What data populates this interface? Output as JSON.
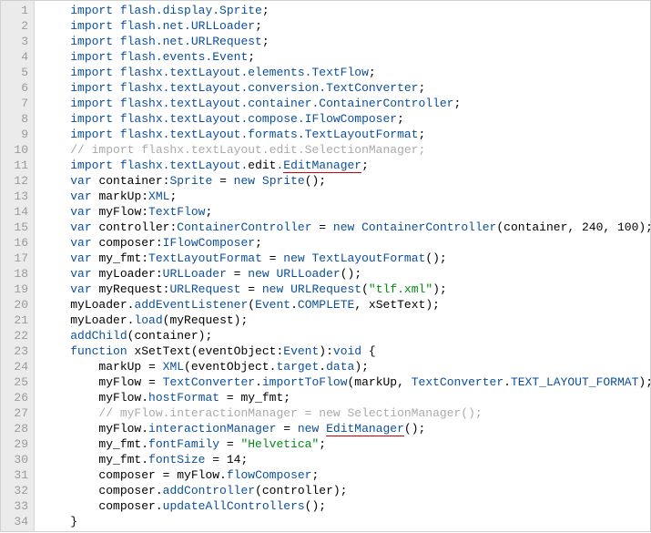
{
  "lines": [
    [
      0,
      {
        "t": "import ",
        "c": "kw"
      },
      {
        "t": "flash.display.Sprite",
        "c": "type"
      },
      {
        "t": ";"
      }
    ],
    [
      0,
      {
        "t": "import ",
        "c": "kw"
      },
      {
        "t": "flash.net.URLLoader",
        "c": "type"
      },
      {
        "t": ";"
      }
    ],
    [
      0,
      {
        "t": "import ",
        "c": "kw"
      },
      {
        "t": "flash.net.URLRequest",
        "c": "type"
      },
      {
        "t": ";"
      }
    ],
    [
      0,
      {
        "t": "import ",
        "c": "kw"
      },
      {
        "t": "flash.events.Event",
        "c": "type"
      },
      {
        "t": ";"
      }
    ],
    [
      0,
      {
        "t": "import ",
        "c": "kw"
      },
      {
        "t": "flashx.textLayout.elements.TextFlow",
        "c": "type"
      },
      {
        "t": ";"
      }
    ],
    [
      0,
      {
        "t": "import ",
        "c": "kw"
      },
      {
        "t": "flashx.textLayout.conversion.TextConverter",
        "c": "type"
      },
      {
        "t": ";"
      }
    ],
    [
      0,
      {
        "t": "import ",
        "c": "kw"
      },
      {
        "t": "flashx.textLayout.container.ContainerController",
        "c": "type"
      },
      {
        "t": ";"
      }
    ],
    [
      0,
      {
        "t": "import ",
        "c": "kw"
      },
      {
        "t": "flashx.textLayout.compose.IFlowComposer",
        "c": "type"
      },
      {
        "t": ";"
      }
    ],
    [
      0,
      {
        "t": "import ",
        "c": "kw"
      },
      {
        "t": "flashx.textLayout.formats.TextLayoutFormat",
        "c": "type"
      },
      {
        "t": ";"
      }
    ],
    [
      0,
      {
        "t": "// import flashx.textLayout.edit.SelectionManager;",
        "c": "com"
      }
    ],
    [
      0,
      {
        "t": "import ",
        "c": "kw"
      },
      {
        "t": "flashx.textLayout.",
        "c": "type"
      },
      {
        "t": "edit"
      },
      {
        "t": ".",
        "c": "type"
      },
      {
        "t": "EditManager",
        "c": "type",
        "u": true
      },
      {
        "t": ";"
      }
    ],
    [
      0,
      {
        "t": "var ",
        "c": "kw"
      },
      {
        "t": "container:"
      },
      {
        "t": "Sprite",
        "c": "type"
      },
      {
        "t": " = "
      },
      {
        "t": "new ",
        "c": "kw"
      },
      {
        "t": "Sprite",
        "c": "type"
      },
      {
        "t": "();"
      }
    ],
    [
      0,
      {
        "t": "var ",
        "c": "kw"
      },
      {
        "t": "markUp:"
      },
      {
        "t": "XML",
        "c": "type"
      },
      {
        "t": ";"
      }
    ],
    [
      0,
      {
        "t": "var ",
        "c": "kw"
      },
      {
        "t": "myFlow:"
      },
      {
        "t": "TextFlow",
        "c": "type"
      },
      {
        "t": ";"
      }
    ],
    [
      0,
      {
        "t": "var ",
        "c": "kw"
      },
      {
        "t": "controller:"
      },
      {
        "t": "ContainerController",
        "c": "type"
      },
      {
        "t": " = "
      },
      {
        "t": "new ",
        "c": "kw"
      },
      {
        "t": "ContainerController",
        "c": "type"
      },
      {
        "t": "(container, 240, 100);"
      }
    ],
    [
      0,
      {
        "t": "var ",
        "c": "kw"
      },
      {
        "t": "composer:"
      },
      {
        "t": "IFlowComposer",
        "c": "type"
      },
      {
        "t": ";"
      }
    ],
    [
      0,
      {
        "t": "var ",
        "c": "kw"
      },
      {
        "t": "my_fmt:"
      },
      {
        "t": "TextLayoutFormat",
        "c": "type"
      },
      {
        "t": " = "
      },
      {
        "t": "new ",
        "c": "kw"
      },
      {
        "t": "TextLayoutFormat",
        "c": "type"
      },
      {
        "t": "();"
      }
    ],
    [
      0,
      {
        "t": "var ",
        "c": "kw"
      },
      {
        "t": "myLoader:"
      },
      {
        "t": "URLLoader",
        "c": "type"
      },
      {
        "t": " = "
      },
      {
        "t": "new ",
        "c": "kw"
      },
      {
        "t": "URLLoader",
        "c": "type"
      },
      {
        "t": "();"
      }
    ],
    [
      0,
      {
        "t": "var ",
        "c": "kw"
      },
      {
        "t": "myRequest:"
      },
      {
        "t": "URLRequest",
        "c": "type"
      },
      {
        "t": " = "
      },
      {
        "t": "new ",
        "c": "kw"
      },
      {
        "t": "URLRequest",
        "c": "type"
      },
      {
        "t": "("
      },
      {
        "t": "\"tlf.xml\"",
        "c": "str"
      },
      {
        "t": ");"
      }
    ],
    [
      0,
      {
        "t": "myLoader."
      },
      {
        "t": "addEventListener",
        "c": "type"
      },
      {
        "t": "("
      },
      {
        "t": "Event",
        "c": "type"
      },
      {
        "t": "."
      },
      {
        "t": "COMPLETE",
        "c": "type"
      },
      {
        "t": ", xSetText);"
      }
    ],
    [
      0,
      {
        "t": "myLoader."
      },
      {
        "t": "load",
        "c": "type"
      },
      {
        "t": "(myRequest);"
      }
    ],
    [
      0,
      {
        "t": "addChild",
        "c": "type"
      },
      {
        "t": "(container);"
      }
    ],
    [
      0,
      {
        "t": "function ",
        "c": "kw"
      },
      {
        "t": "xSetText(eventObject:"
      },
      {
        "t": "Event",
        "c": "type"
      },
      {
        "t": "):"
      },
      {
        "t": "void",
        "c": "kw"
      },
      {
        "t": " {"
      }
    ],
    [
      1,
      {
        "t": "markUp = "
      },
      {
        "t": "XML",
        "c": "type"
      },
      {
        "t": "(eventObject."
      },
      {
        "t": "target",
        "c": "type"
      },
      {
        "t": "."
      },
      {
        "t": "data",
        "c": "type"
      },
      {
        "t": ");"
      }
    ],
    [
      1,
      {
        "t": "myFlow = "
      },
      {
        "t": "TextConverter",
        "c": "type"
      },
      {
        "t": "."
      },
      {
        "t": "importToFlow",
        "c": "type"
      },
      {
        "t": "(markUp, "
      },
      {
        "t": "TextConverter",
        "c": "type"
      },
      {
        "t": "."
      },
      {
        "t": "TEXT_LAYOUT_FORMAT",
        "c": "type"
      },
      {
        "t": ");"
      }
    ],
    [
      1,
      {
        "t": "myFlow."
      },
      {
        "t": "hostFormat",
        "c": "type"
      },
      {
        "t": " = my_fmt;"
      }
    ],
    [
      1,
      {
        "t": "// myFlow.interactionManager = new SelectionManager();",
        "c": "com"
      }
    ],
    [
      1,
      {
        "t": "myFlow."
      },
      {
        "t": "interactionManager",
        "c": "type"
      },
      {
        "t": " = "
      },
      {
        "t": "new ",
        "c": "kw"
      },
      {
        "t": "EditManager",
        "c": "type",
        "u": true
      },
      {
        "t": "();"
      }
    ],
    [
      1,
      {
        "t": "my_fmt."
      },
      {
        "t": "fontFamily",
        "c": "type"
      },
      {
        "t": " = "
      },
      {
        "t": "\"Helvetica\"",
        "c": "str"
      },
      {
        "t": ";"
      }
    ],
    [
      1,
      {
        "t": "my_fmt."
      },
      {
        "t": "fontSize",
        "c": "type"
      },
      {
        "t": " = 14;"
      }
    ],
    [
      1,
      {
        "t": "composer = myFlow."
      },
      {
        "t": "flowComposer",
        "c": "type"
      },
      {
        "t": ";"
      }
    ],
    [
      1,
      {
        "t": "composer."
      },
      {
        "t": "addController",
        "c": "type"
      },
      {
        "t": "(controller);"
      }
    ],
    [
      1,
      {
        "t": "composer."
      },
      {
        "t": "updateAllControllers",
        "c": "type"
      },
      {
        "t": "();"
      }
    ],
    [
      0,
      {
        "t": "}"
      }
    ]
  ],
  "indentUnit": "    ",
  "baseIndent": "    "
}
